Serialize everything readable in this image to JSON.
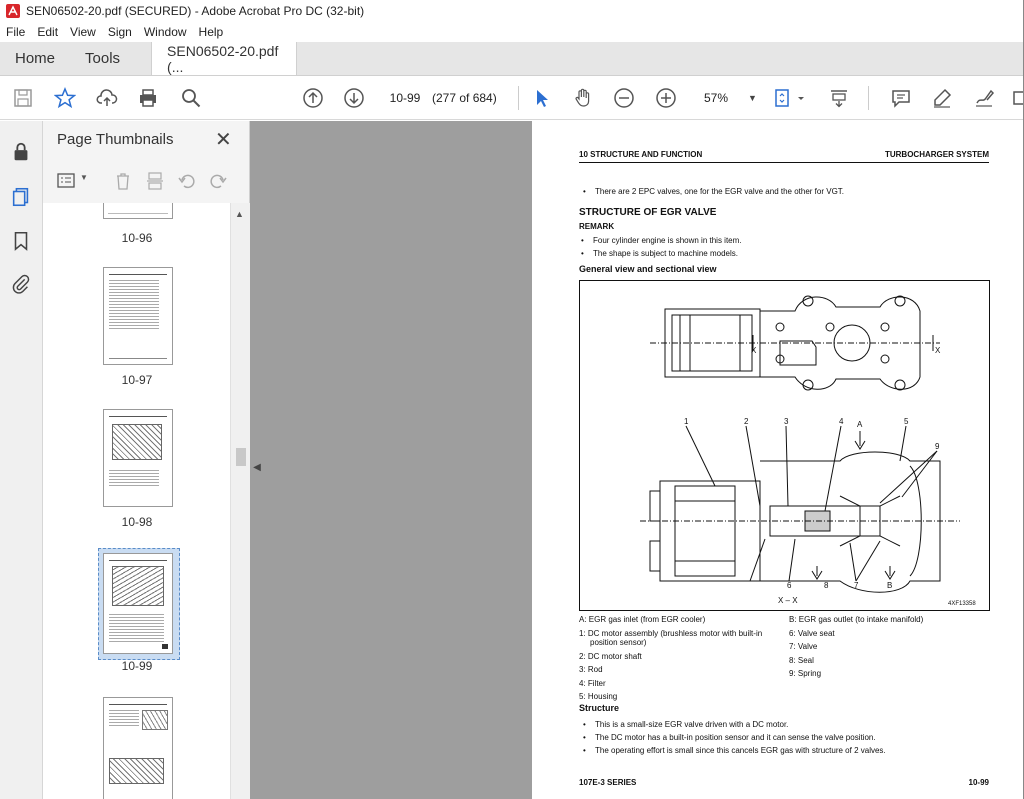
{
  "window": {
    "title": "SEN06502-20.pdf (SECURED) - Adobe Acrobat Pro DC (32-bit)"
  },
  "menu": [
    "File",
    "Edit",
    "View",
    "Sign",
    "Window",
    "Help"
  ],
  "tabs": {
    "home": "Home",
    "tools": "Tools",
    "document": "SEN06502-20.pdf (..."
  },
  "toolbar": {
    "page_value": "10-99",
    "page_count": "(277 of 684)",
    "zoom": "57%"
  },
  "panel": {
    "title": "Page Thumbnails",
    "thumbnails": [
      {
        "label": "10-96"
      },
      {
        "label": "10-97"
      },
      {
        "label": "10-98"
      },
      {
        "label": "10-99",
        "selected": true
      },
      {
        "label": ""
      }
    ]
  },
  "page": {
    "header_left": "10 STRUCTURE AND FUNCTION",
    "header_right": "TURBOCHARGER SYSTEM",
    "intro_bullet": "There are 2 EPC valves, one for the EGR valve and the other for VGT.",
    "section_title": "STRUCTURE OF EGR VALVE",
    "remark_title": "REMARK",
    "remark_bullets": [
      "Four cylinder engine is shown in this item.",
      "The shape is subject to machine models."
    ],
    "view_title": "General view and sectional view",
    "figure_code": "4XF13358",
    "figure_callouts": [
      "1",
      "2",
      "3",
      "4",
      "5",
      "6",
      "7",
      "8",
      "9",
      "A",
      "B",
      "X",
      "X",
      "X – X"
    ],
    "legend_left": [
      "A: EGR gas inlet (from EGR cooler)",
      "1: DC motor assembly (brushless motor with built-in",
      "position sensor)",
      "2: DC motor shaft",
      "3: Rod",
      "4: Filter",
      "5: Housing"
    ],
    "legend_right": [
      "B: EGR gas outlet (to intake manifold)",
      "6: Valve seat",
      "7: Valve",
      "8: Seal",
      "9: Spring"
    ],
    "structure_title": "Structure",
    "structure_bullets": [
      "This is a small-size EGR valve driven with a DC motor.",
      "The DC motor has a built-in position sensor and it can sense the valve position.",
      "The operating effort is small since this cancels EGR gas with structure of 2 valves."
    ],
    "footer_left": "107E-3 SERIES",
    "footer_right": "10-99"
  },
  "colors": {
    "accent": "#2c6fd1",
    "canvas": "#9e9e9e",
    "selected_thumb": "#c9dcf2"
  }
}
